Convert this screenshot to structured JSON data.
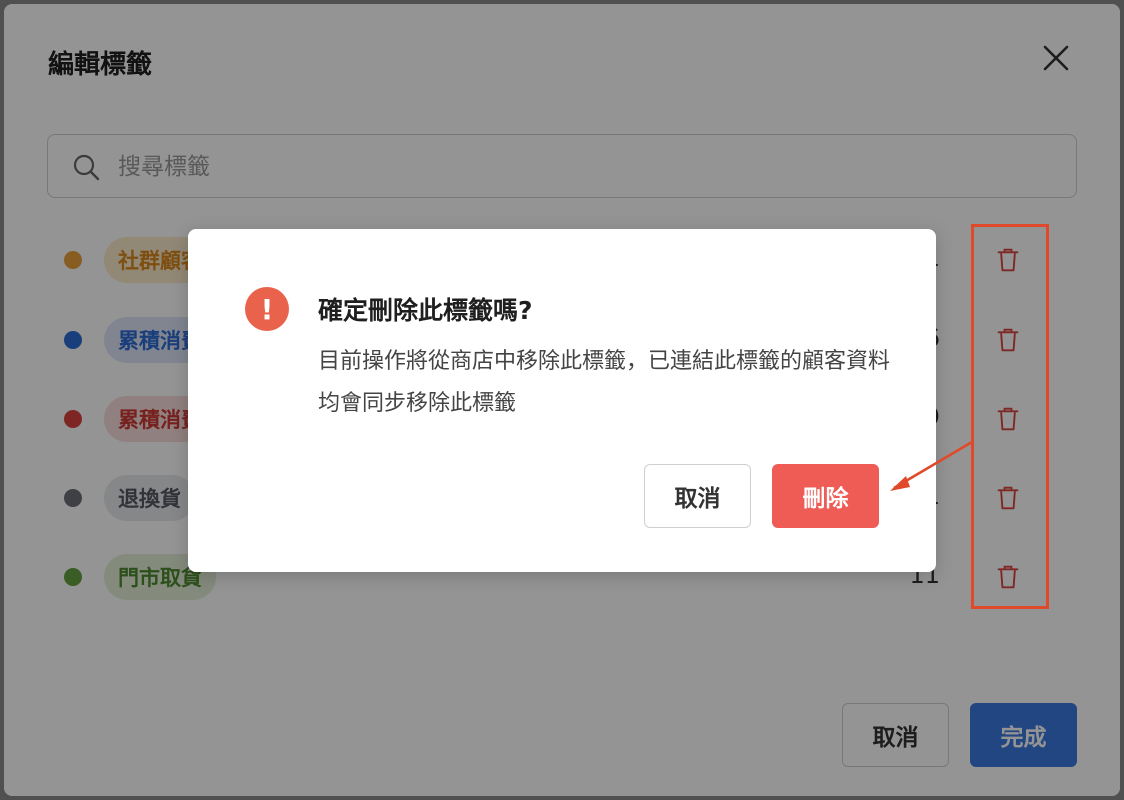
{
  "panel": {
    "title": "編輯標籤",
    "search": {
      "placeholder": "搜尋標籤",
      "value": ""
    },
    "tags": [
      {
        "label": "社群顧客",
        "count": "1",
        "dot_color": "#e8a13a",
        "pill_bg": "#fbeacc",
        "pill_color": "#d9891c"
      },
      {
        "label": "累積消費",
        "count": "6",
        "dot_color": "#2e6bd6",
        "pill_bg": "#dde6f7",
        "pill_color": "#2e6bd6"
      },
      {
        "label": "累積消費",
        "count": "9",
        "dot_color": "#d9433e",
        "pill_bg": "#f8dcdb",
        "pill_color": "#cc3a35"
      },
      {
        "label": "退換貨",
        "count": "1",
        "dot_color": "#6c6f78",
        "pill_bg": "#e7e8eb",
        "pill_color": "#555963"
      },
      {
        "label": "門市取貨",
        "count": "11",
        "dot_color": "#62a03e",
        "pill_bg": "#e3efd8",
        "pill_color": "#4f8a2f"
      }
    ],
    "cancel_label": "取消",
    "done_label": "完成"
  },
  "dialog": {
    "icon": "warning-icon",
    "title": "確定刪除此標籤嗎?",
    "message": "目前操作將從商店中移除此標籤，已連結此標籤的顧客資料均會同步移除此標籤",
    "cancel_label": "取消",
    "delete_label": "刪除"
  },
  "colors": {
    "danger": "#ef5b55",
    "primary": "#3a79e0",
    "annotation": "#e04a2b"
  }
}
